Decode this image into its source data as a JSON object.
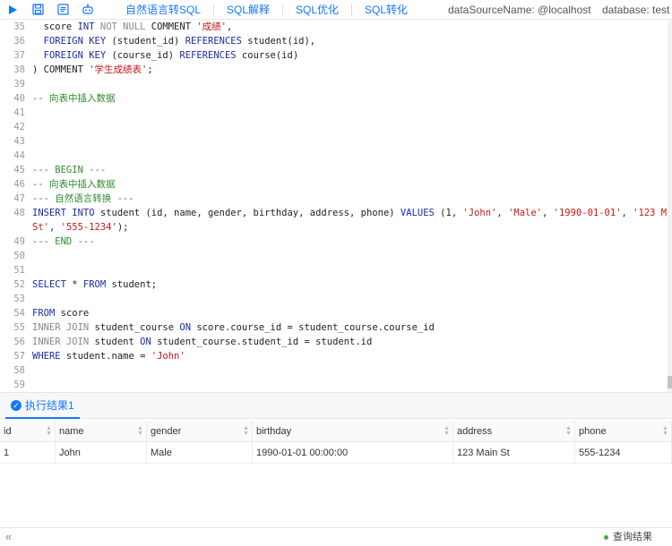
{
  "toolbar": {
    "icons": [
      "run-icon",
      "save-icon",
      "format-icon",
      "robot-icon"
    ],
    "links": [
      "自然语言转SQL",
      "SQL解释",
      "SQL优化",
      "SQL转化"
    ],
    "datasource": "dataSourceName: @localhost",
    "database": "database: test"
  },
  "editor": {
    "lines": [
      {
        "n": "35",
        "segs": [
          [
            "  score ",
            ""
          ],
          [
            "INT",
            "kw"
          ],
          [
            " ",
            ""
          ],
          [
            "NOT NULL",
            "kw2"
          ],
          [
            " COMMENT ",
            ""
          ],
          [
            "'成绩'",
            "str"
          ],
          [
            ",",
            ""
          ]
        ]
      },
      {
        "n": "36",
        "segs": [
          [
            "  ",
            ""
          ],
          [
            "FOREIGN KEY",
            "kw"
          ],
          [
            " (student_id) ",
            ""
          ],
          [
            "REFERENCES",
            "kw"
          ],
          [
            " student(id),",
            ""
          ]
        ]
      },
      {
        "n": "37",
        "segs": [
          [
            "  ",
            ""
          ],
          [
            "FOREIGN KEY",
            "kw"
          ],
          [
            " (course_id) ",
            ""
          ],
          [
            "REFERENCES",
            "kw"
          ],
          [
            " course(id)",
            ""
          ]
        ]
      },
      {
        "n": "38",
        "segs": [
          [
            ") COMMENT ",
            ""
          ],
          [
            "'学生成绩表'",
            "str"
          ],
          [
            ";",
            ""
          ]
        ]
      },
      {
        "n": "39",
        "segs": []
      },
      {
        "n": "40",
        "segs": [
          [
            "-- 向表中插入数据",
            "cm"
          ]
        ]
      },
      {
        "n": "41",
        "segs": []
      },
      {
        "n": "42",
        "segs": []
      },
      {
        "n": "43",
        "segs": []
      },
      {
        "n": "44",
        "segs": []
      },
      {
        "n": "45",
        "segs": [
          [
            "--- BEGIN ---",
            "cm"
          ]
        ]
      },
      {
        "n": "46",
        "segs": [
          [
            "-- 向表中插入数据",
            "cm"
          ]
        ]
      },
      {
        "n": "47",
        "segs": [
          [
            "--- 自然语言转换 ---",
            "cm"
          ]
        ]
      },
      {
        "n": "48",
        "segs": [
          [
            "INSERT INTO",
            "kw"
          ],
          [
            " student (id, name, gender, birthday, address, phone) ",
            ""
          ],
          [
            "VALUES",
            "kw"
          ],
          [
            " (1, ",
            ""
          ],
          [
            "'John'",
            "str"
          ],
          [
            ", ",
            ""
          ],
          [
            "'Male'",
            "str"
          ],
          [
            ", ",
            ""
          ],
          [
            "'1990-01-01'",
            "str"
          ],
          [
            ", ",
            ""
          ],
          [
            "'123 Main",
            "str"
          ]
        ]
      },
      {
        "n": "",
        "segs": [
          [
            "St'",
            "str"
          ],
          [
            ", ",
            ""
          ],
          [
            "'555-1234'",
            "str"
          ],
          [
            ");",
            ""
          ]
        ]
      },
      {
        "n": "49",
        "segs": [
          [
            "--- END ---",
            "cm"
          ]
        ]
      },
      {
        "n": "50",
        "segs": []
      },
      {
        "n": "51",
        "segs": []
      },
      {
        "n": "52",
        "segs": [
          [
            "SELECT",
            "kw"
          ],
          [
            " * ",
            ""
          ],
          [
            "FROM",
            "kw"
          ],
          [
            " student;",
            ""
          ]
        ]
      },
      {
        "n": "53",
        "segs": []
      },
      {
        "n": "54",
        "segs": [
          [
            "FROM",
            "kw"
          ],
          [
            " score",
            ""
          ]
        ]
      },
      {
        "n": "55",
        "segs": [
          [
            "INNER JOIN",
            "kw2"
          ],
          [
            " student_course ",
            ""
          ],
          [
            "ON",
            "kw"
          ],
          [
            " score.course_id = student_course.course_id",
            ""
          ]
        ]
      },
      {
        "n": "56",
        "segs": [
          [
            "INNER JOIN",
            "kw2"
          ],
          [
            " student ",
            ""
          ],
          [
            "ON",
            "kw"
          ],
          [
            " student_course.student_id = student.id",
            ""
          ]
        ]
      },
      {
        "n": "57",
        "segs": [
          [
            "WHERE",
            "kw"
          ],
          [
            " student.name = ",
            ""
          ],
          [
            "'John'",
            "str"
          ]
        ]
      },
      {
        "n": "58",
        "segs": []
      },
      {
        "n": "59",
        "segs": []
      }
    ]
  },
  "results": {
    "tab_label": "执行结果1",
    "columns": [
      "id",
      "name",
      "gender",
      "birthday",
      "address",
      "phone"
    ],
    "rows": [
      [
        "1",
        "John",
        "Male",
        "1990-01-01 00:00:00",
        "123 Main St",
        "555-1234"
      ]
    ]
  },
  "status": {
    "collapse": "«",
    "query_result": "查询结果"
  },
  "colors": {
    "accent": "#1677ff",
    "keyword": "#1e2ca8",
    "string": "#c41a16",
    "comment": "#2f8b2f",
    "status_ok": "#3bb34a"
  }
}
